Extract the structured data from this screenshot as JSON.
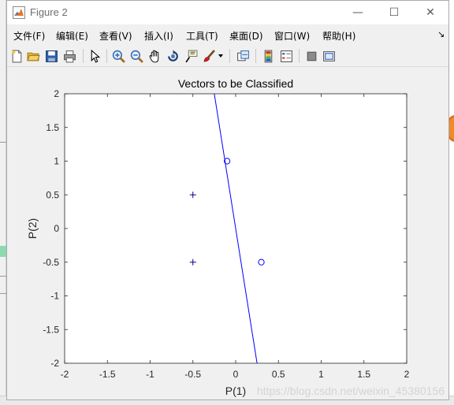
{
  "window": {
    "title": "Figure 2",
    "controls": {
      "minimize": "—",
      "maximize": "☐",
      "close": "✕"
    }
  },
  "menu": {
    "items": [
      "文件(F)",
      "编辑(E)",
      "查看(V)",
      "插入(I)",
      "工具(T)",
      "桌面(D)",
      "窗口(W)",
      "帮助(H)"
    ],
    "overflow_arrow": "↘"
  },
  "toolbar": {
    "buttons": [
      "new-figure-icon",
      "open-file-icon",
      "save-icon",
      "print-icon",
      "select-arrow-icon",
      "zoom-in-icon",
      "zoom-out-icon",
      "pan-hand-icon",
      "rotate-3d-icon",
      "data-cursor-icon",
      "brush-icon",
      "dropdown-arrow-icon",
      "link-plot-icon",
      "insert-colorbar-icon",
      "insert-legend-icon",
      "hide-plot-tools-icon",
      "show-plot-tools-icon"
    ]
  },
  "colors": {
    "line": "#0000ff",
    "plus": "#000080",
    "circle": "#0000ff"
  },
  "watermark": "https://blog.csdn.net/weixin_45380156",
  "chart_data": {
    "type": "scatter",
    "title": "Vectors to be Classified",
    "xlabel": "P(1)",
    "ylabel": "P(2)",
    "xlim": [
      -2,
      2
    ],
    "ylim": [
      -2,
      2
    ],
    "xticks": [
      "-2",
      "-1.5",
      "-1",
      "-0.5",
      "0",
      "0.5",
      "1",
      "1.5",
      "2"
    ],
    "yticks": [
      "-2",
      "-1.5",
      "-1",
      "-0.5",
      "0",
      "0.5",
      "1",
      "1.5",
      "2"
    ],
    "grid": false,
    "series": [
      {
        "marker": "plus",
        "x": [
          -0.5,
          -0.5
        ],
        "y": [
          0.5,
          -0.5
        ]
      },
      {
        "marker": "circle",
        "x": [
          -0.1,
          0.3
        ],
        "y": [
          1.0,
          -0.5
        ]
      }
    ],
    "decision_line": {
      "x": [
        -0.25,
        0.25
      ],
      "y": [
        2.0,
        -2.0
      ]
    }
  }
}
